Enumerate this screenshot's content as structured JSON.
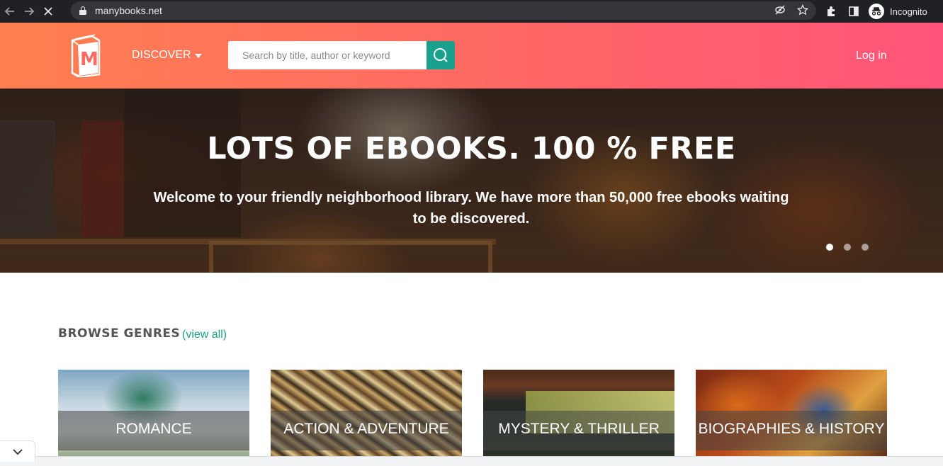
{
  "browser": {
    "url": "manybooks.net",
    "profile_label": "Incognito",
    "icons": [
      "back-icon",
      "forward-icon",
      "stop-icon",
      "lock-icon",
      "eye-off-icon",
      "star-icon",
      "puzzle-icon",
      "sidebar-icon",
      "incognito-icon"
    ]
  },
  "header": {
    "logo_letter": "M",
    "discover_label": "DISCOVER",
    "search_placeholder": "Search by title, author or keyword",
    "login_label": "Log in",
    "colors": {
      "gradient_start": "#ff7f50",
      "gradient_end": "#ff5479",
      "search_button": "#1aa08c"
    }
  },
  "hero": {
    "title": "LOTS OF EBOOKS. 100 % FREE",
    "subtitle": "Welcome to your friendly neighborhood library. We have more than 50,000 free ebooks waiting to be discovered.",
    "slides_total": 3,
    "active_slide": 1
  },
  "browse": {
    "title": "BROWSE GENRES",
    "view_all": "(view all)",
    "genres": [
      {
        "label": "ROMANCE"
      },
      {
        "label": "ACTION & ADVENTURE"
      },
      {
        "label": "MYSTERY & THRILLER"
      },
      {
        "label": "BIOGRAPHIES & HISTORY"
      }
    ],
    "accent_color": "#1aa08c"
  }
}
